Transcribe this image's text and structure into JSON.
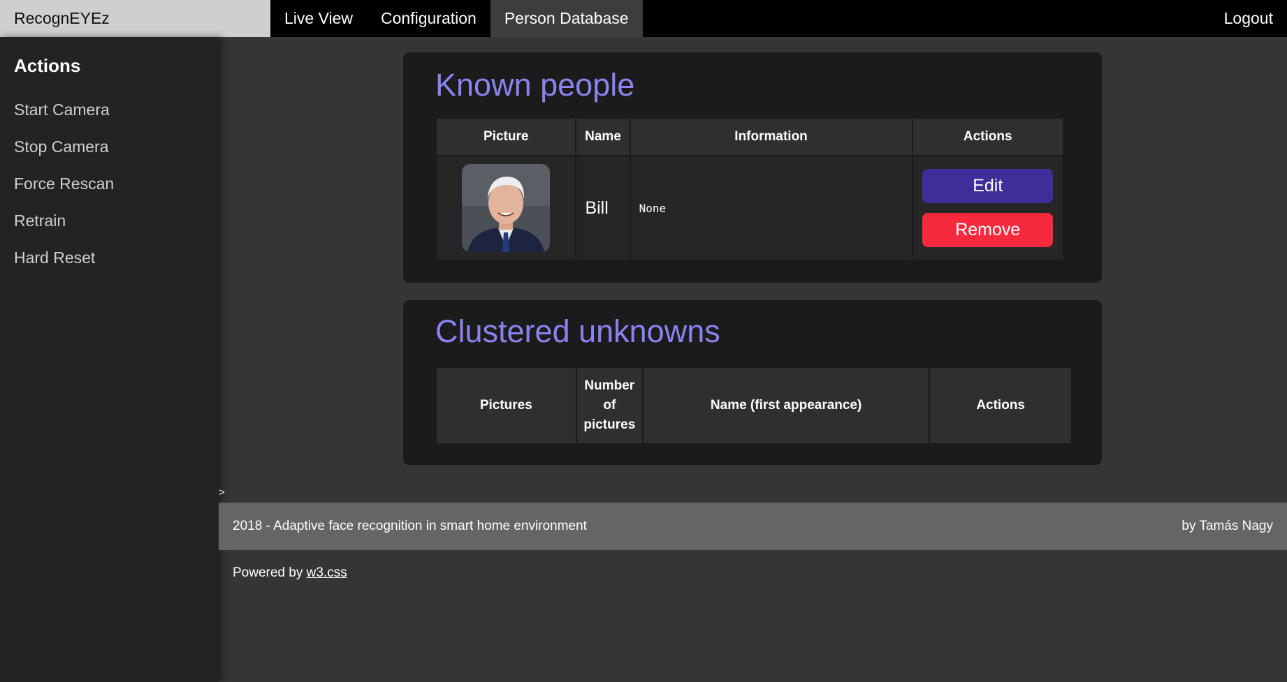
{
  "app": {
    "brand": "RecognEYEz"
  },
  "nav": {
    "items": [
      {
        "label": "Live View"
      },
      {
        "label": "Configuration"
      },
      {
        "label": "Person Database",
        "active": true
      }
    ],
    "logout_label": "Logout"
  },
  "sidebar": {
    "title": "Actions",
    "items": [
      {
        "label": "Start Camera"
      },
      {
        "label": "Stop Camera"
      },
      {
        "label": "Force Rescan"
      },
      {
        "label": "Retrain"
      },
      {
        "label": "Hard Reset"
      }
    ]
  },
  "known": {
    "title": "Known people",
    "headers": [
      "Picture",
      "Name",
      "Information",
      "Actions"
    ],
    "rows": [
      {
        "name": "Bill",
        "information": "None",
        "edit_label": "Edit",
        "remove_label": "Remove"
      }
    ]
  },
  "unknown": {
    "title": "Clustered unknowns",
    "headers": [
      "Pictures",
      "Number of pictures",
      "Name (first appearance)",
      "Actions"
    ]
  },
  "stray_text": ">",
  "footer": {
    "left": "2018 - Adaptive face recognition in smart home environment",
    "right": "by Tamás Nagy"
  },
  "powered": {
    "prefix": "Powered by ",
    "link": "w3.css"
  },
  "colors": {
    "accent_title": "#8a83f0",
    "edit_button": "#3d2e9a",
    "remove_button": "#f7293d",
    "panel_bg": "#1b1b1b",
    "page_bg": "#353535"
  }
}
